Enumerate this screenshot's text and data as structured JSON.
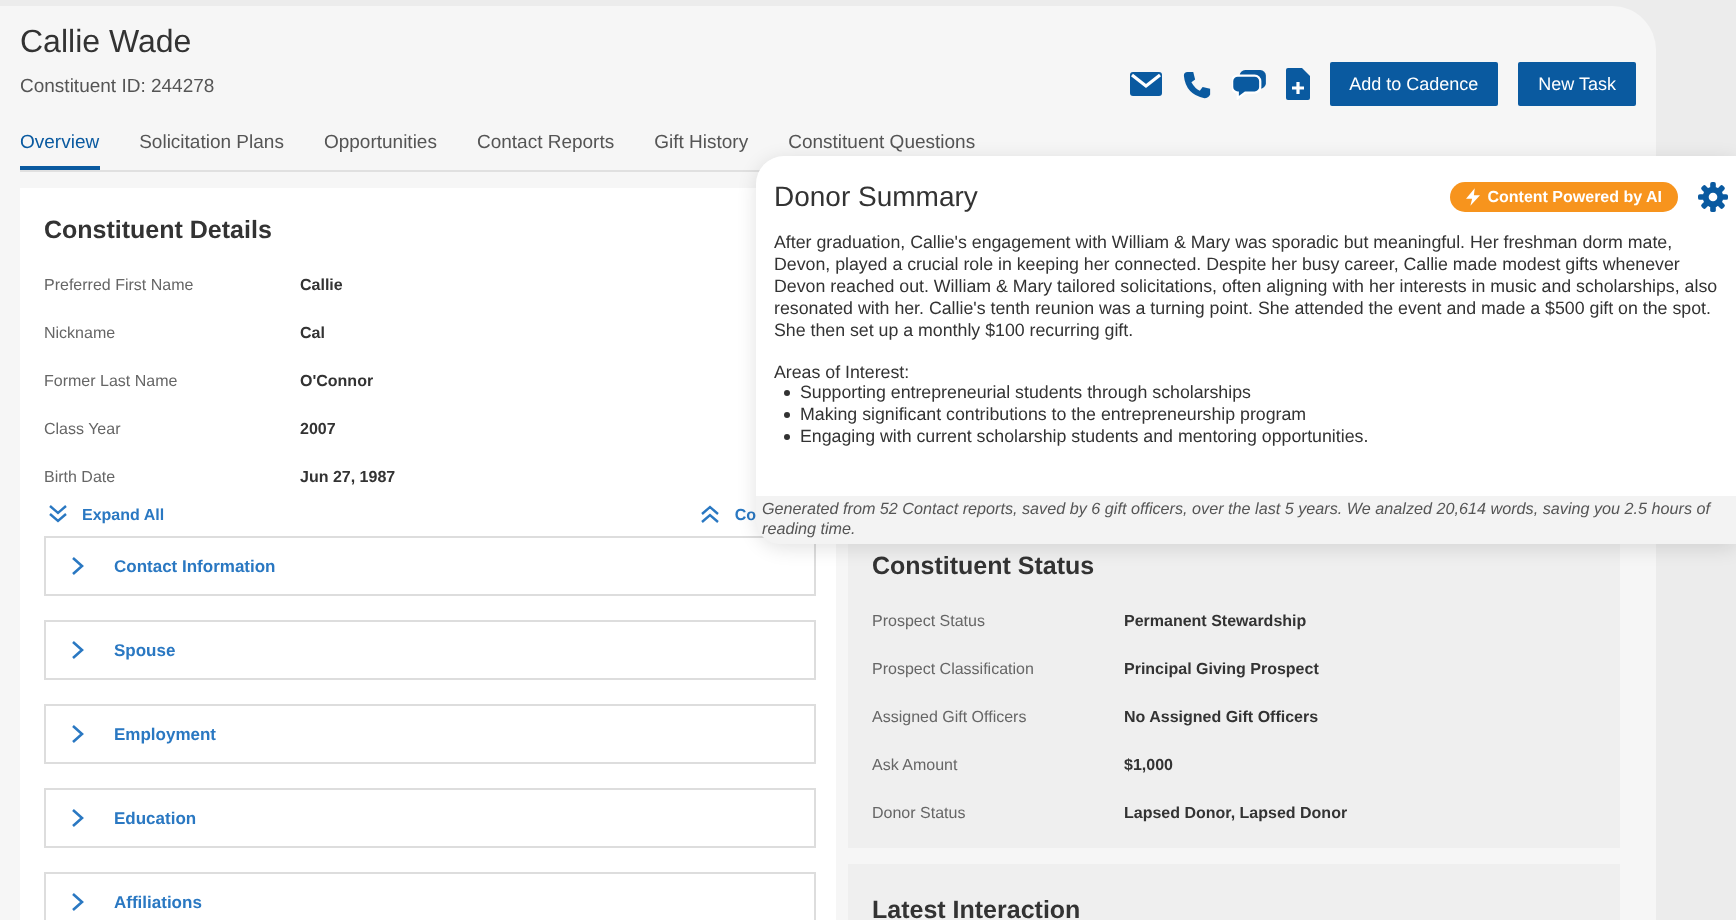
{
  "header": {
    "name": "Callie Wade",
    "constituent_id": "Constituent ID: 244278",
    "buttons": [
      "Add to Cadence",
      "New Task"
    ]
  },
  "tabs": [
    {
      "label": "Overview",
      "selected": true
    },
    {
      "label": "Solicitation Plans",
      "selected": false
    },
    {
      "label": "Opportunities",
      "selected": false
    },
    {
      "label": "Contact Reports",
      "selected": false
    },
    {
      "label": "Gift History",
      "selected": false
    },
    {
      "label": "Constituent Questions",
      "selected": false
    }
  ],
  "constituent_details": {
    "title": "Constituent Details",
    "fields": [
      {
        "label": "Preferred First Name",
        "value": "Callie"
      },
      {
        "label": "Nickname",
        "value": "Cal"
      },
      {
        "label": "Former Last Name",
        "value": "O'Connor"
      },
      {
        "label": "Class Year",
        "value": "2007"
      },
      {
        "label": "Birth Date",
        "value": "Jun 27, 1987"
      }
    ],
    "expand_all": "Expand All",
    "collapse_all": "Co",
    "sections": [
      {
        "label": "Contact Information",
        "expanded": false
      },
      {
        "label": "Spouse",
        "expanded": false
      },
      {
        "label": "Employment",
        "expanded": false
      },
      {
        "label": "Education",
        "expanded": false
      },
      {
        "label": "Affiliations",
        "expanded": false
      }
    ]
  },
  "constituent_status": {
    "title": "Constituent Status",
    "fields": [
      {
        "label": "Prospect Status",
        "value": "Permanent Stewardship"
      },
      {
        "label": "Prospect Classification",
        "value": "Principal Giving Prospect"
      },
      {
        "label": "Assigned Gift Officers",
        "value": "No Assigned Gift Officers"
      },
      {
        "label": "Ask Amount",
        "value": "$1,000"
      },
      {
        "label": "Donor Status",
        "value": "Lapsed Donor, Lapsed Donor"
      }
    ]
  },
  "latest_interaction": {
    "title": "Latest Interaction"
  },
  "donor_summary": {
    "title": "Donor Summary",
    "badge": "Content Powered by AI",
    "body": "After graduation, Callie's engagement with William & Mary was sporadic but meaningful. Her freshman dorm mate, Devon, played a crucial role in keeping her connected. Despite her busy career, Callie made modest gifts whenever Devon reached out. William & Mary tailored solicitations, often aligning with her interests in music and scholarships, also resonated with her. Callie's tenth reunion was a turning point. She attended the event and made a $500 gift on the spot. She then set up a monthly $100 recurring gift.",
    "interests_heading": "Areas of Interest:",
    "interests": [
      "Supporting entrepreneurial students through scholarships",
      "Making significant contributions to the entrepreneurship program",
      "Engaging with current scholarship students and mentoring opportunities."
    ],
    "footer": "Generated from 52 Contact reports, saved by 6 gift officers, over the last 5 years. We analzed 20,614 words, saving you 2.5 hours of reading time."
  }
}
